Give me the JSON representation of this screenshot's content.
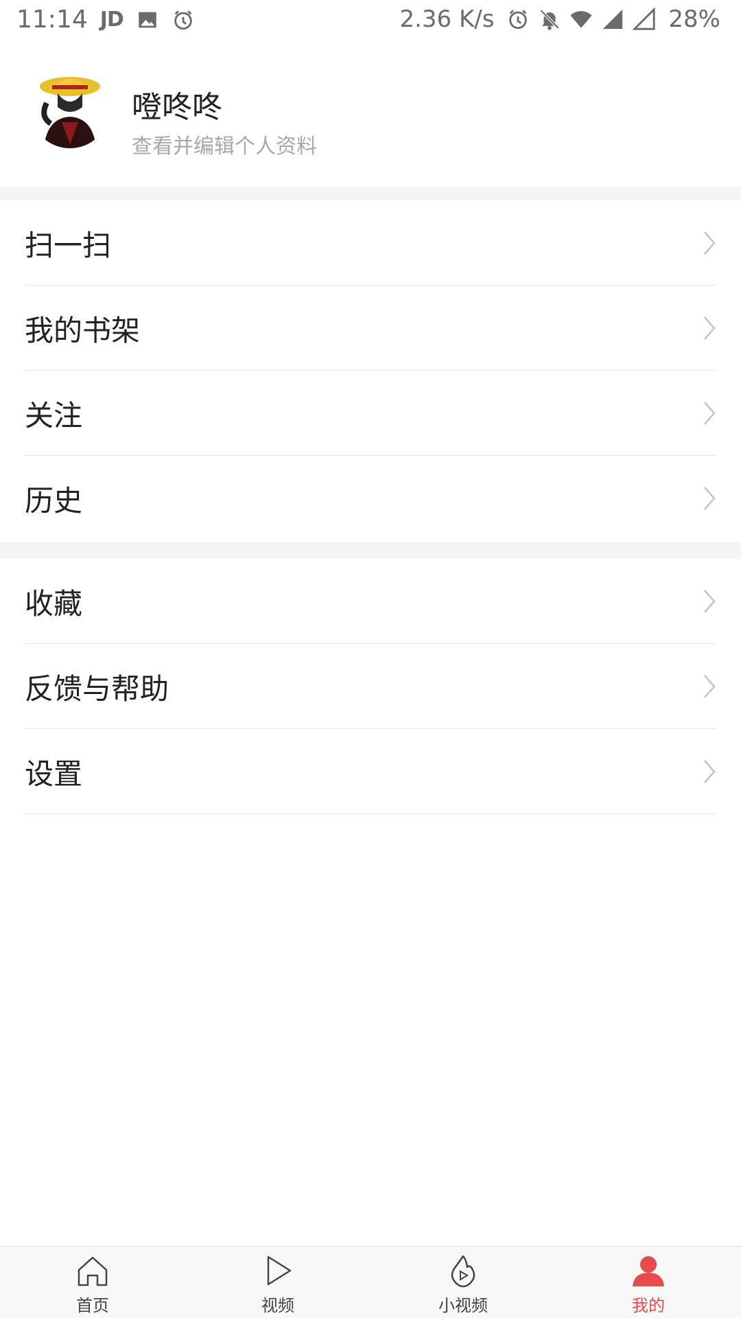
{
  "status_bar": {
    "time": "11:14",
    "jd_label": "JD",
    "net_speed": "2.36 K/s",
    "battery": "28%",
    "icons": [
      "image-icon",
      "alarm-icon",
      "alarm-icon",
      "mute-icon",
      "wifi-icon",
      "signal-icon",
      "signal-empty-icon"
    ]
  },
  "profile": {
    "name": "噔咚咚",
    "subtitle": "查看并编辑个人资料"
  },
  "menu": {
    "group1": [
      {
        "label": "扫一扫"
      },
      {
        "label": "我的书架"
      },
      {
        "label": "关注"
      },
      {
        "label": "历史"
      }
    ],
    "group2": [
      {
        "label": "收藏"
      },
      {
        "label": "反馈与帮助"
      },
      {
        "label": "设置"
      }
    ]
  },
  "tabs": [
    {
      "label": "首页",
      "icon": "home-icon"
    },
    {
      "label": "视频",
      "icon": "play-icon"
    },
    {
      "label": "小视频",
      "icon": "flame-play-icon"
    },
    {
      "label": "我的",
      "icon": "person-icon",
      "active": true
    }
  ],
  "colors": {
    "accent": "#e74c4c",
    "text": "#222222",
    "muted": "#a8a8a8",
    "separator": "#f4f4f4"
  }
}
